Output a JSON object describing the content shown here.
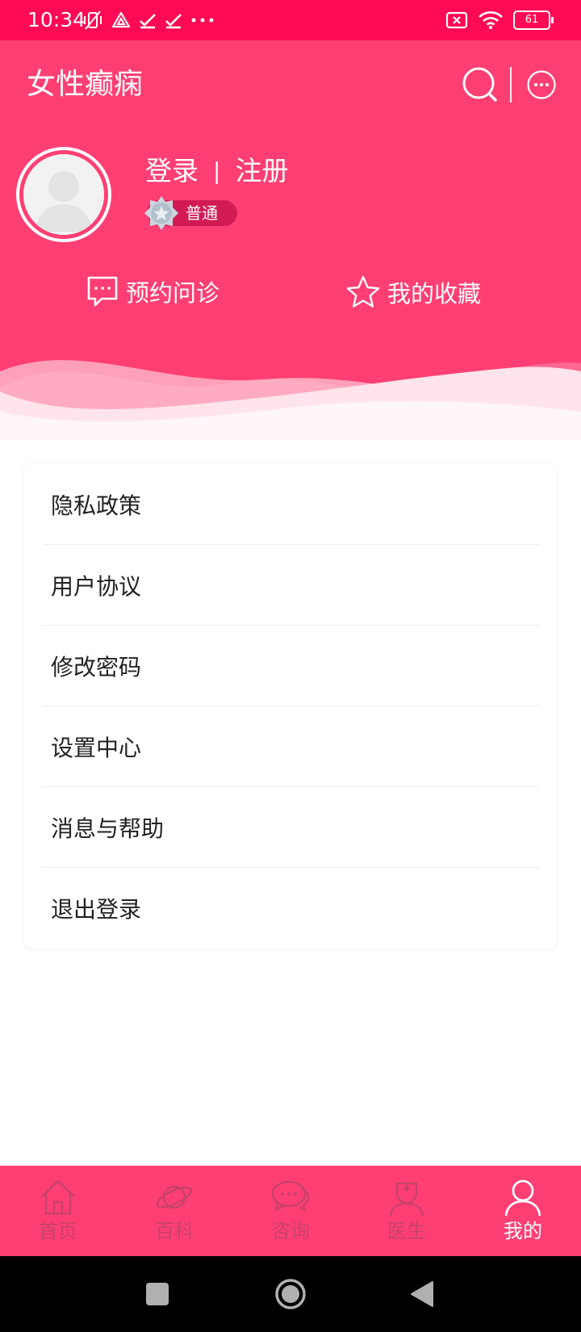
{
  "status_bar": {
    "time": "10:34",
    "battery": "61",
    "left_icons": [
      "vibrate-off-icon",
      "drive-icon",
      "check-icon",
      "check-icon",
      "more-dots-icon"
    ],
    "right_icons": [
      "sim-off-icon",
      "wifi-icon",
      "battery-icon"
    ]
  },
  "header": {
    "title": "女性癫痫",
    "search_icon": "search-icon",
    "more_icon": "more-circle-icon"
  },
  "profile": {
    "login_label": "登录",
    "separator": "|",
    "register_label": "注册",
    "level_label": "普通"
  },
  "quick_actions": {
    "appointment_label": "预约问诊",
    "favorites_label": "我的收藏"
  },
  "menu": {
    "items": [
      {
        "label": "隐私政策"
      },
      {
        "label": "用户协议"
      },
      {
        "label": "修改密码"
      },
      {
        "label": "设置中心"
      },
      {
        "label": "消息与帮助"
      },
      {
        "label": "退出登录"
      }
    ]
  },
  "bottom_nav": {
    "items": [
      {
        "label": "首页",
        "icon": "home-icon"
      },
      {
        "label": "百科",
        "icon": "planet-icon"
      },
      {
        "label": "咨询",
        "icon": "chat-icon"
      },
      {
        "label": "医生",
        "icon": "doctor-icon"
      },
      {
        "label": "我的",
        "icon": "user-icon",
        "active": true
      }
    ]
  },
  "colors": {
    "status_bar": "#ff0a54",
    "primary": "#ff3f73",
    "badge": "#d21b55",
    "nav_inactive": "#c9416b",
    "nav_active": "#ffffff"
  }
}
